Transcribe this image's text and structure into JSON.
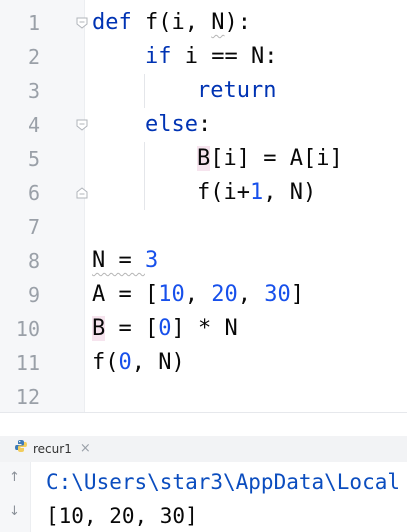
{
  "editor": {
    "line_numbers": [
      "1",
      "2",
      "3",
      "4",
      "5",
      "6",
      "7",
      "8",
      "9",
      "10",
      "11",
      "12"
    ],
    "code": {
      "l1_kw": "def",
      "l1_rest_a": " f(i, ",
      "l1_rest_b": "N",
      "l1_rest_c": "):",
      "l2_kw": "if",
      "l2_rest": " i == N:",
      "l3_kw": "return",
      "l4_kw": "else",
      "l4_rest": ":",
      "l5_a": "B",
      "l5_b": "[i] = A[i]",
      "l6_a": "f(i+",
      "l6_num": "1",
      "l6_b": ", N)",
      "l8_a": "N = ",
      "l8_num": "3",
      "l9_a": "A = [",
      "l9_n1": "10",
      "l9_c1": ", ",
      "l9_n2": "20",
      "l9_c2": ", ",
      "l9_n3": "30",
      "l9_b": "]",
      "l10_a": "B",
      "l10_b": " = [",
      "l10_num": "0",
      "l10_c": "] * N",
      "l11_a": "f(",
      "l11_num": "0",
      "l11_b": ", N)"
    }
  },
  "run_panel": {
    "tab_label": "recur1",
    "tab_close": "×",
    "console_lines": [
      "C:\\Users\\star3\\AppData\\Local",
      "[10, 20, 30]"
    ],
    "up_arrow": "↑",
    "down_arrow": "↓"
  },
  "colors": {
    "keyword": "#0033b3",
    "number": "#1750eb",
    "console_path": "#0b4dbf",
    "highlight": "#f6e4ee"
  }
}
